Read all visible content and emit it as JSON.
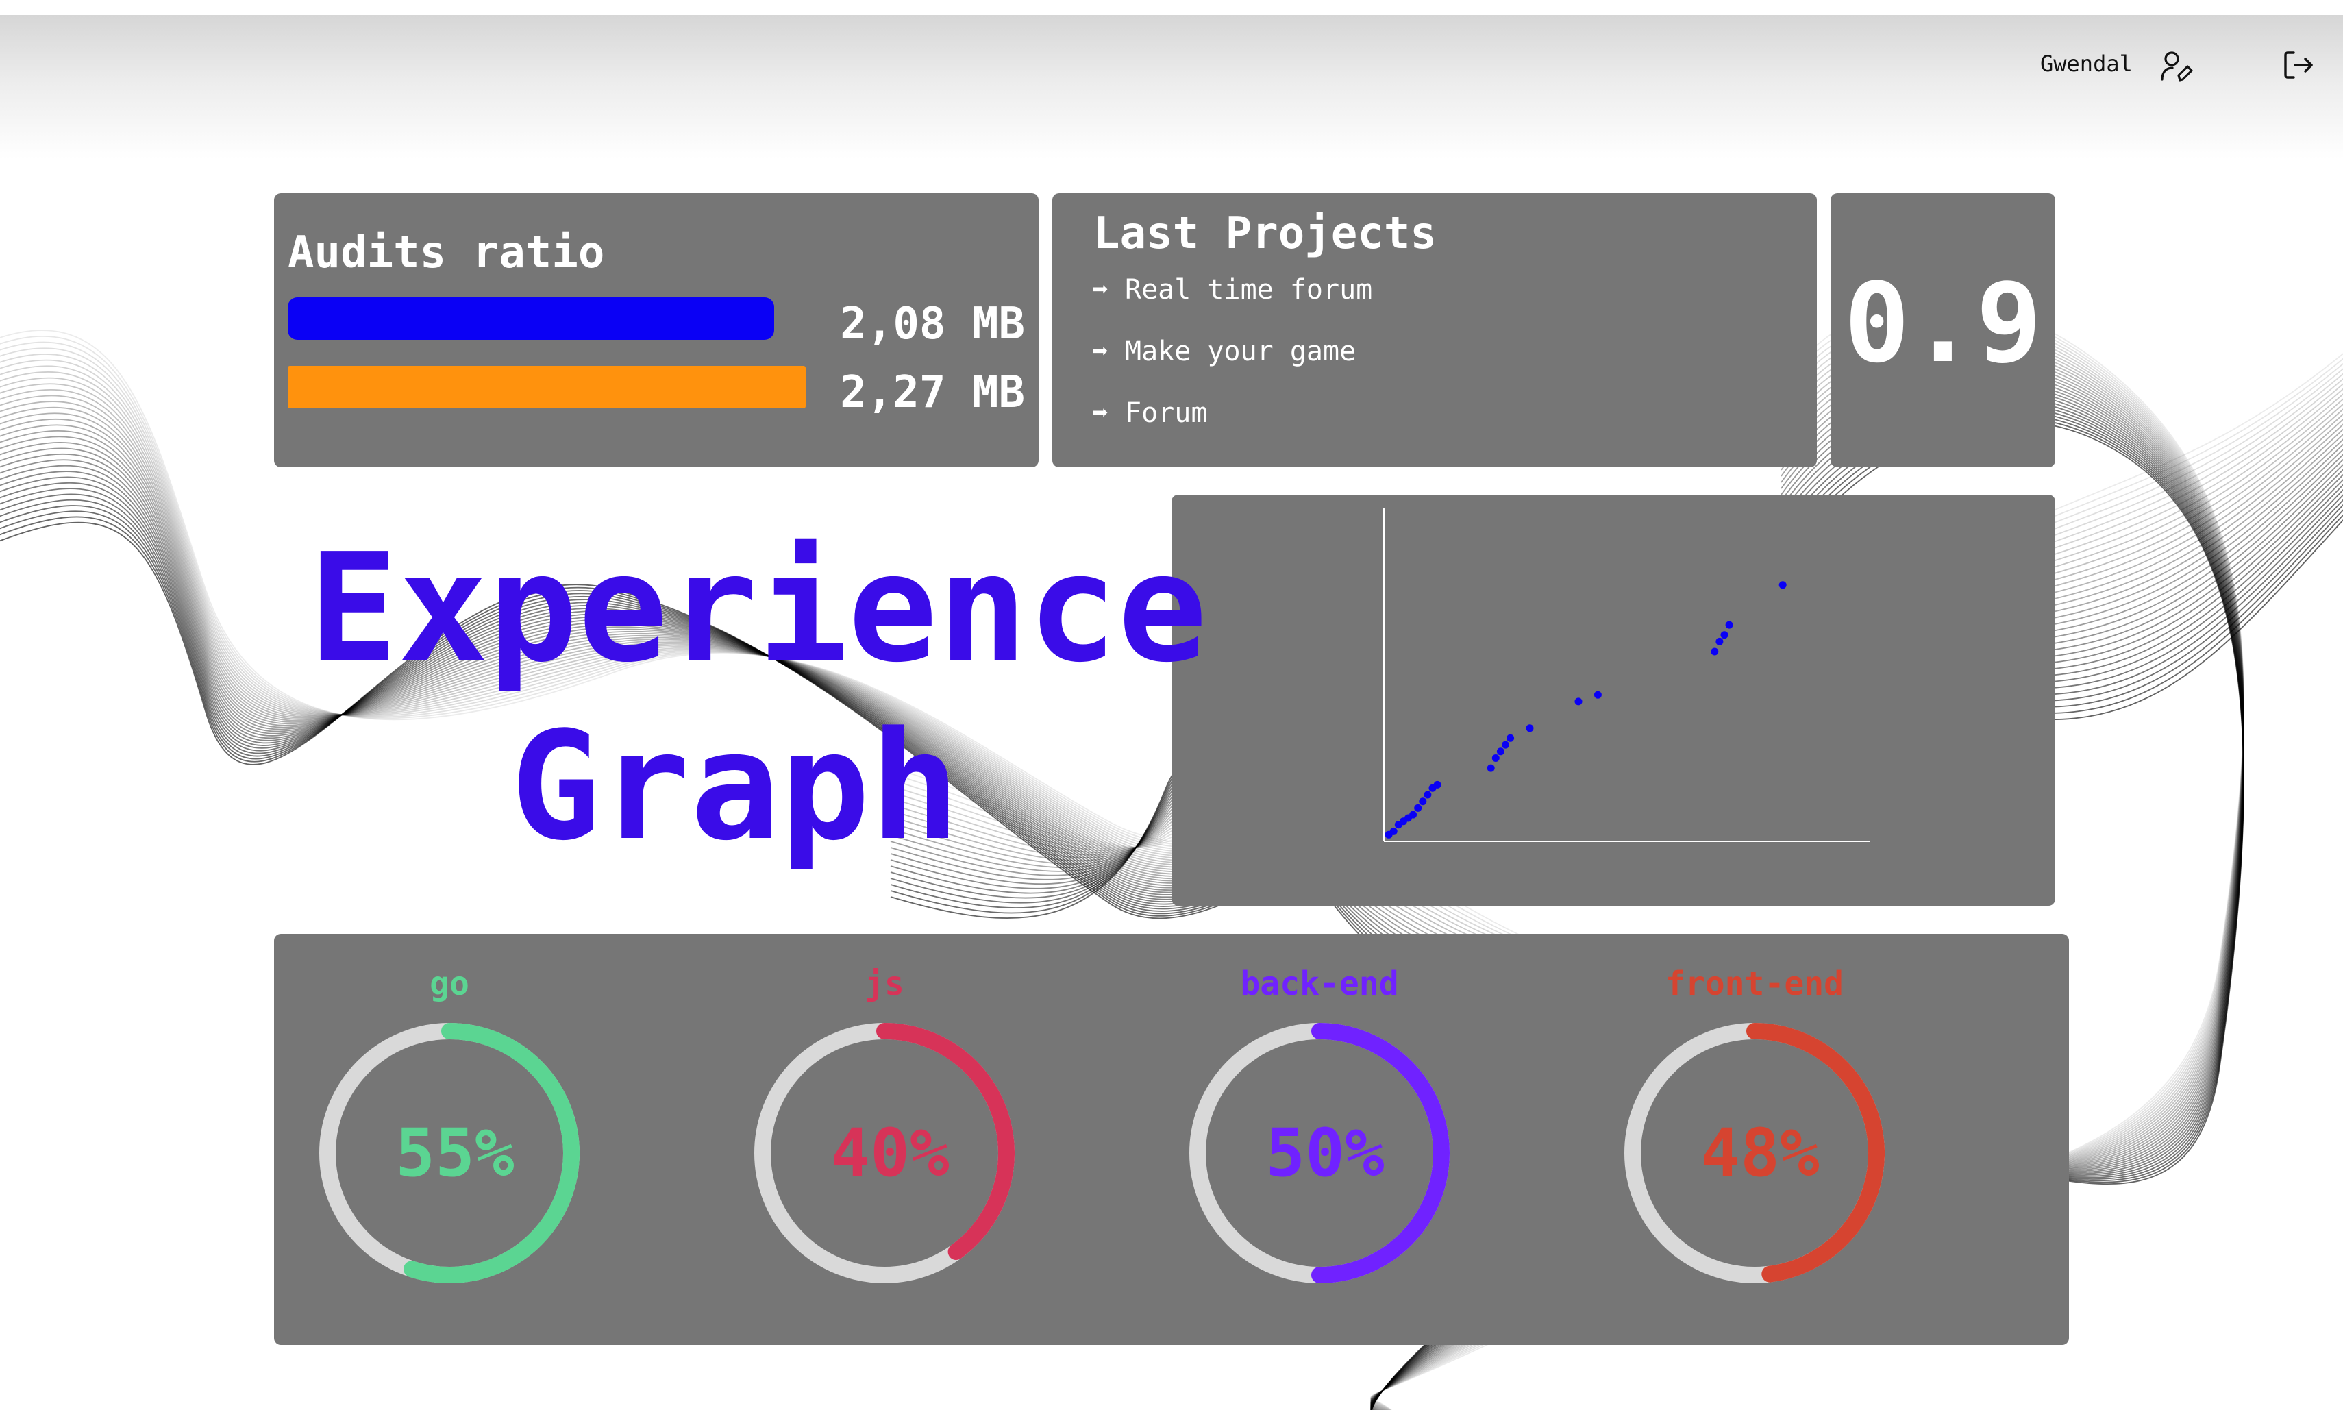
{
  "header": {
    "user_name": "Gwendal",
    "user_icon": "user-edit-icon",
    "logout_icon": "logout-icon"
  },
  "audit_ratio": {
    "title": "Audits ratio",
    "done_value": "2,08 MB",
    "received_value": "2,27 MB",
    "done_amount": 2.08,
    "received_amount": 2.27,
    "done_color": "#0a00f5",
    "received_color": "#ff920d"
  },
  "last_projects": {
    "title": "Last Projects",
    "arrow": "➡",
    "items": [
      "Real time forum",
      "Make your game",
      "Forum"
    ]
  },
  "ratio": {
    "value": "0.9"
  },
  "experience": {
    "title_line1": "Experience",
    "title_line2": "Graph",
    "title_color": "#3a0ce8"
  },
  "chart_data": {
    "type": "scatter",
    "title": "",
    "xlabel": "",
    "ylabel": "",
    "grid": false,
    "color": "#0a00f5",
    "x": [
      1,
      2,
      3,
      4,
      5,
      6,
      7,
      8,
      9,
      10,
      11,
      22,
      23,
      24,
      25,
      26,
      30,
      40,
      44,
      68,
      69,
      70,
      71,
      82
    ],
    "y": [
      2,
      3,
      5,
      6,
      7,
      8,
      10,
      12,
      14,
      16,
      17,
      22,
      25,
      27,
      29,
      31,
      34,
      42,
      44,
      57,
      60,
      62,
      65,
      77
    ],
    "xlim": [
      0,
      100
    ],
    "ylim": [
      0,
      100
    ]
  },
  "skills": [
    {
      "name": "go",
      "percent_label": "55%",
      "value": 55,
      "color": "#5bd592"
    },
    {
      "name": "js",
      "percent_label": "40%",
      "value": 40,
      "color": "#d73358"
    },
    {
      "name": "back-end",
      "percent_label": "50%",
      "value": 50,
      "color": "#7022ff"
    },
    {
      "name": "front-end",
      "percent_label": "48%",
      "value": 48,
      "color": "#d64430"
    }
  ],
  "skill_track_color": "#d9d9d9",
  "card_color": "#767676"
}
